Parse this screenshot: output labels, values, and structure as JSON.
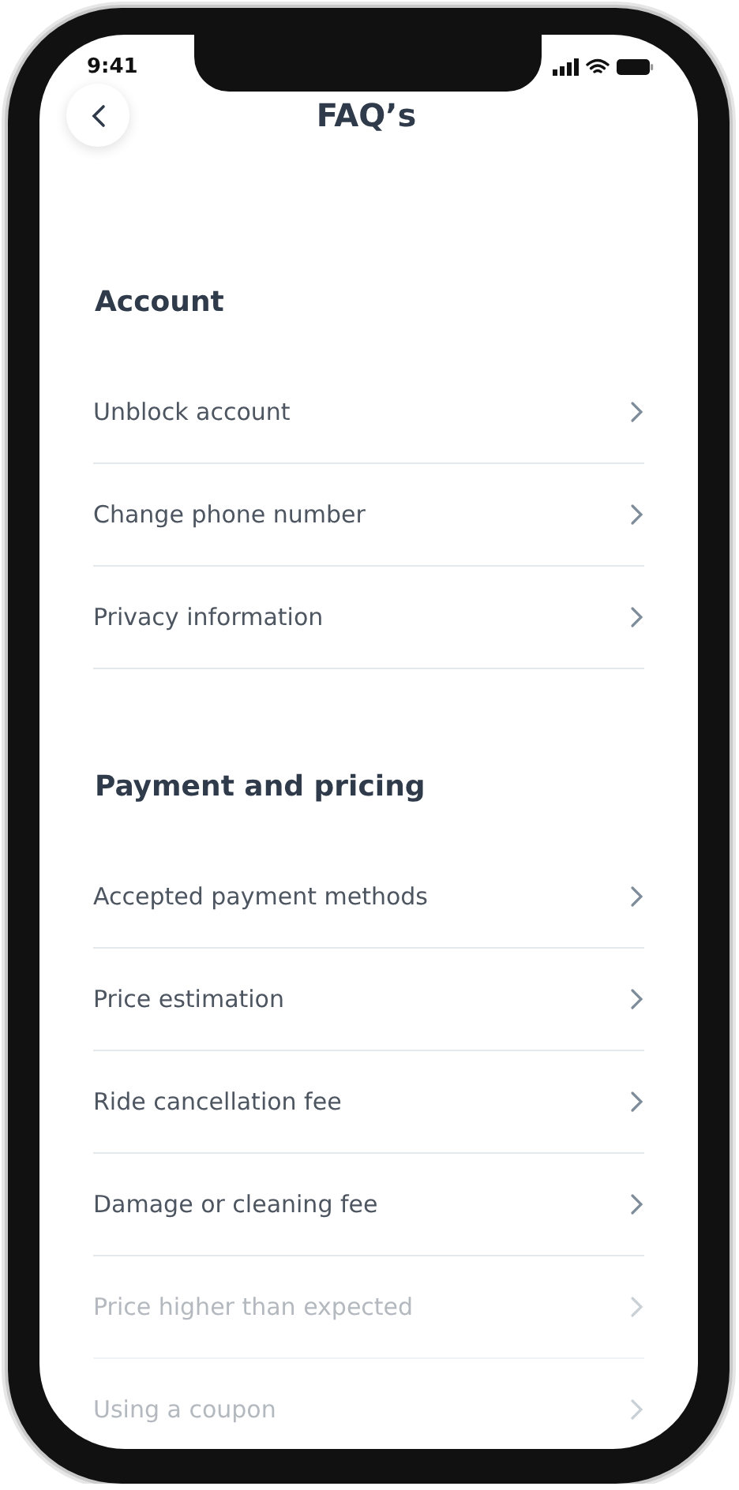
{
  "status_bar": {
    "time": "9:41"
  },
  "header": {
    "title": "FAQ’s"
  },
  "sections": [
    {
      "title": "Account",
      "items": [
        {
          "label": "Unblock account",
          "faded": false
        },
        {
          "label": "Change phone number",
          "faded": false
        },
        {
          "label": "Privacy information",
          "faded": false
        }
      ]
    },
    {
      "title": "Payment and pricing",
      "items": [
        {
          "label": "Accepted payment methods",
          "faded": false
        },
        {
          "label": "Price estimation",
          "faded": false
        },
        {
          "label": "Ride cancellation fee",
          "faded": false
        },
        {
          "label": "Damage or cleaning fee",
          "faded": false
        },
        {
          "label": "Price higher than expected",
          "faded": true
        },
        {
          "label": "Using a coupon",
          "faded": true
        }
      ]
    }
  ]
}
